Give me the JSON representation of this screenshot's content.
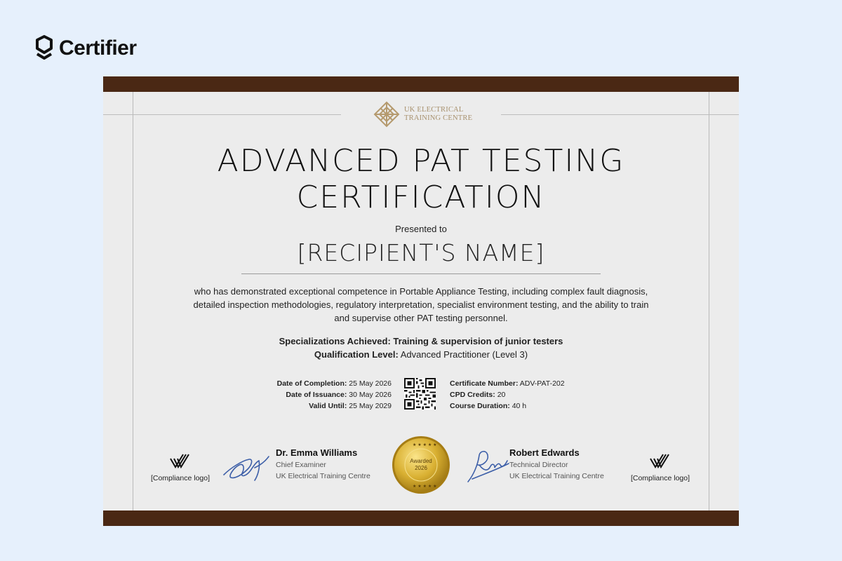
{
  "brand": {
    "name": "Certifier",
    "icon": "certifier-shield-icon"
  },
  "organization": {
    "line1": "UK ELECTRICAL",
    "line2": "TRAINING CENTRE",
    "icon": "lattice-logo-icon"
  },
  "certificate": {
    "title_line1": "ADVANCED PAT TESTING",
    "title_line2": "CERTIFICATION",
    "presented_to": "Presented to",
    "recipient": "[RECIPIENT'S NAME]",
    "description": "who has demonstrated exceptional competence in Portable Appliance Testing, including complex fault diagnosis, detailed inspection methodologies, regulatory interpretation, specialist environment testing, and the ability to train and supervise other PAT testing personnel.",
    "specializations_label": "Specializations Achieved:",
    "specializations_value": "Training & supervision of junior testers",
    "qualification_label": "Qualification Level:",
    "qualification_value": "Advanced Practitioner (Level 3)"
  },
  "details": {
    "completion_label": "Date of Completion:",
    "completion_value": "25 May 2026",
    "issuance_label": "Date of Issuance:",
    "issuance_value": "30 May 2026",
    "valid_label": "Valid Until:",
    "valid_value": "25 May 2029",
    "cert_number_label": "Certificate Number:",
    "cert_number_value": "ADV-PAT-202",
    "cpd_label": "CPD Credits:",
    "cpd_value": "20",
    "duration_label": "Course Duration:",
    "duration_value": "40 h"
  },
  "signatories": [
    {
      "name": "Dr. Emma Williams",
      "role": "Chief Examiner",
      "org": "UK Electrical Training Centre"
    },
    {
      "name": "Robert Edwards",
      "role": "Technical Director",
      "org": "UK Electrical Training Centre"
    }
  ],
  "seal": {
    "line1": "Awarded",
    "line2": "2026"
  },
  "compliance": {
    "left_label": "[Compliance logo]",
    "right_label": "[Compliance logo]"
  },
  "colors": {
    "bar": "#4a2814",
    "paper": "#ececec",
    "gold": "#c9a227",
    "signature_ink": "#3d5fa8",
    "background": "#e6f0fc"
  }
}
